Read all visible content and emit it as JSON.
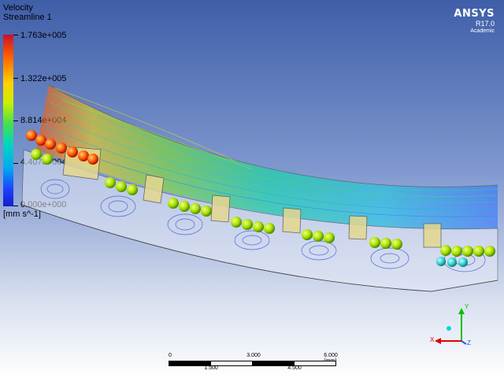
{
  "legend": {
    "variable": "Velocity",
    "plot": "Streamline 1",
    "ticks": [
      "1.763e+005",
      "1.322e+005",
      "8.814e+004",
      "4.407e+004",
      "0.000e+000"
    ],
    "units": "[mm s^-1]"
  },
  "branding": {
    "brand": "ANSYS",
    "version": "R17.0",
    "edition": "Academic"
  },
  "scale_bar": {
    "top_labels": [
      "0",
      "3.000",
      "6.000 (mm)"
    ],
    "bottom_labels": [
      "1.500",
      "4.500"
    ]
  },
  "triad": {
    "y_label": "Y",
    "x_label": "X",
    "z_label": "Z",
    "colors": {
      "y": "#00c000",
      "x": "#e00000",
      "z": "#1060ff",
      "center": "#00d8d8"
    }
  },
  "colors": {
    "background_top": "#3f5ea8",
    "background_bottom": "#ffffff",
    "high_velocity": "#ff3a00",
    "low_velocity": "#1030ff"
  }
}
